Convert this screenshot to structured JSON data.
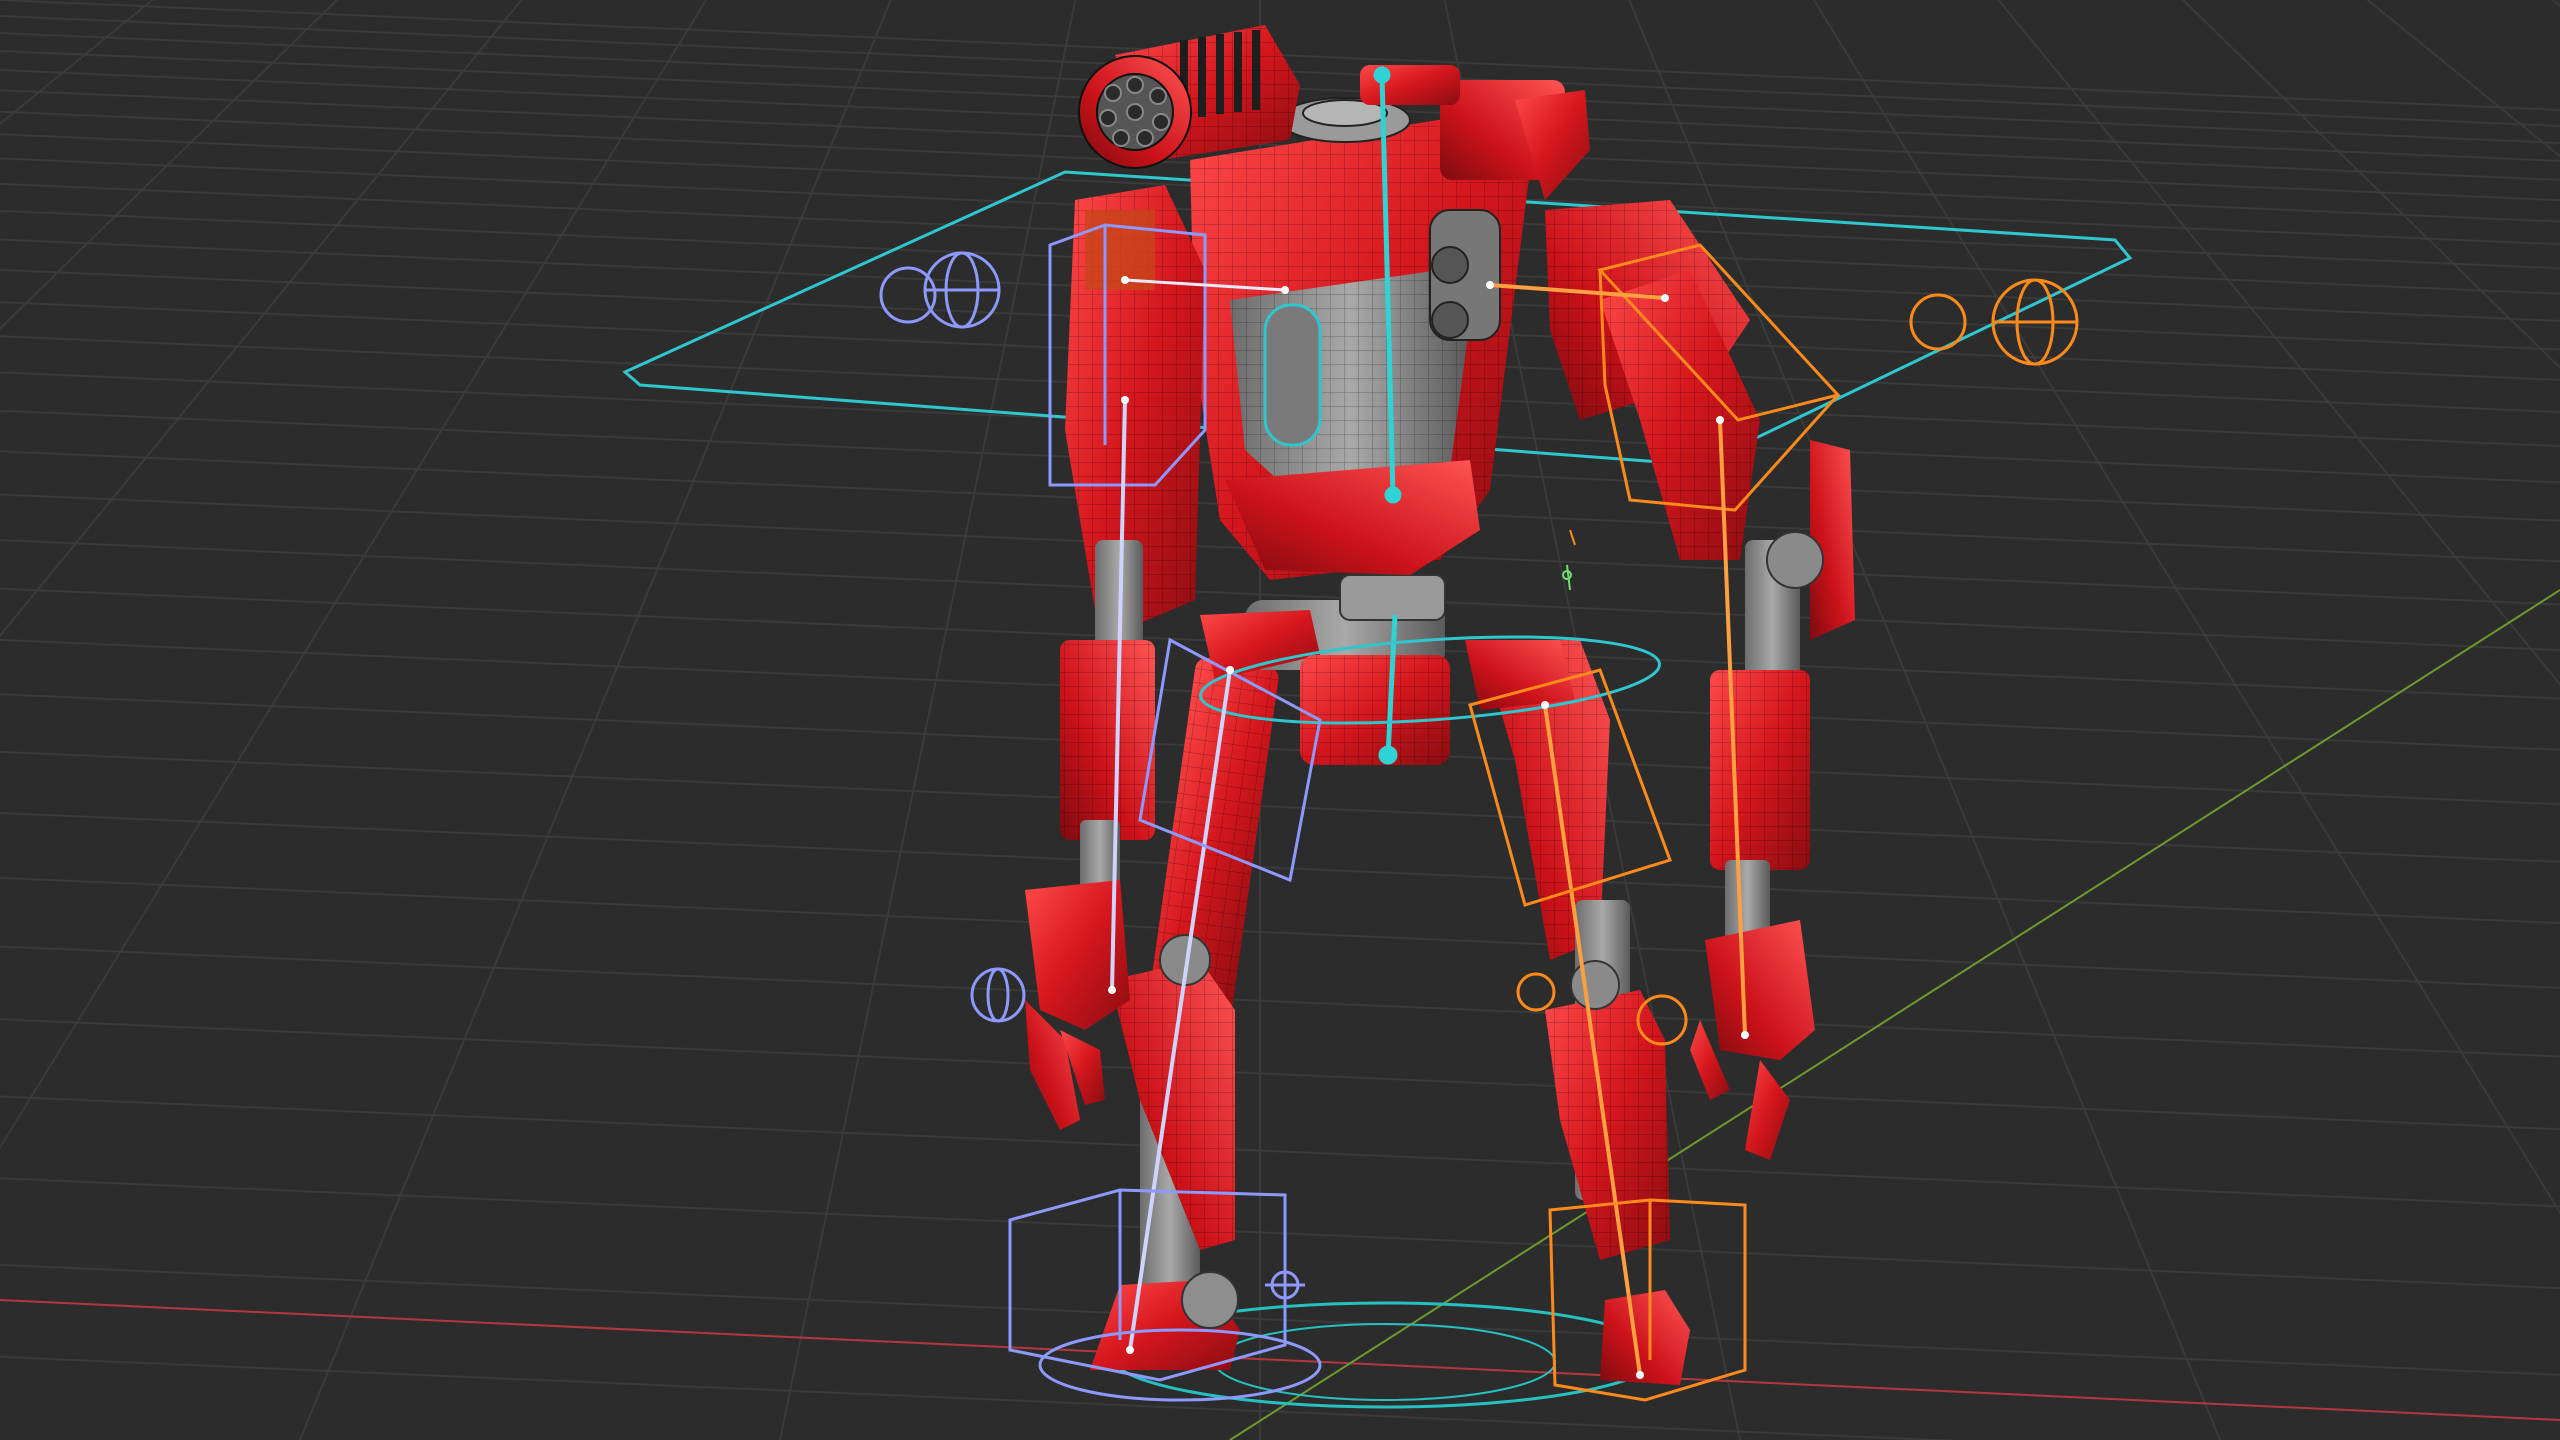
{
  "viewport": {
    "mode": "3d-viewport",
    "background": "#2c2c2c",
    "grid_color": "#3a3a3a",
    "x_axis_color": "#b3383d",
    "y_axis_color": "#6f9a2c"
  },
  "model": {
    "subject": "robot-mech",
    "body_color": "#d8232a",
    "joint_color": "#8f8f8f",
    "wire_color": "#1a1a1a"
  },
  "rig": {
    "left_side_color": "#8d99ff",
    "right_side_color": "#ff8a1c",
    "center_color": "#2fd3d3",
    "root_controller_color": "#27c0c0"
  },
  "icons": [
    "ik-pole-sphere-icon",
    "bone-icon",
    "controller-circle-icon",
    "cube-controller-icon"
  ]
}
